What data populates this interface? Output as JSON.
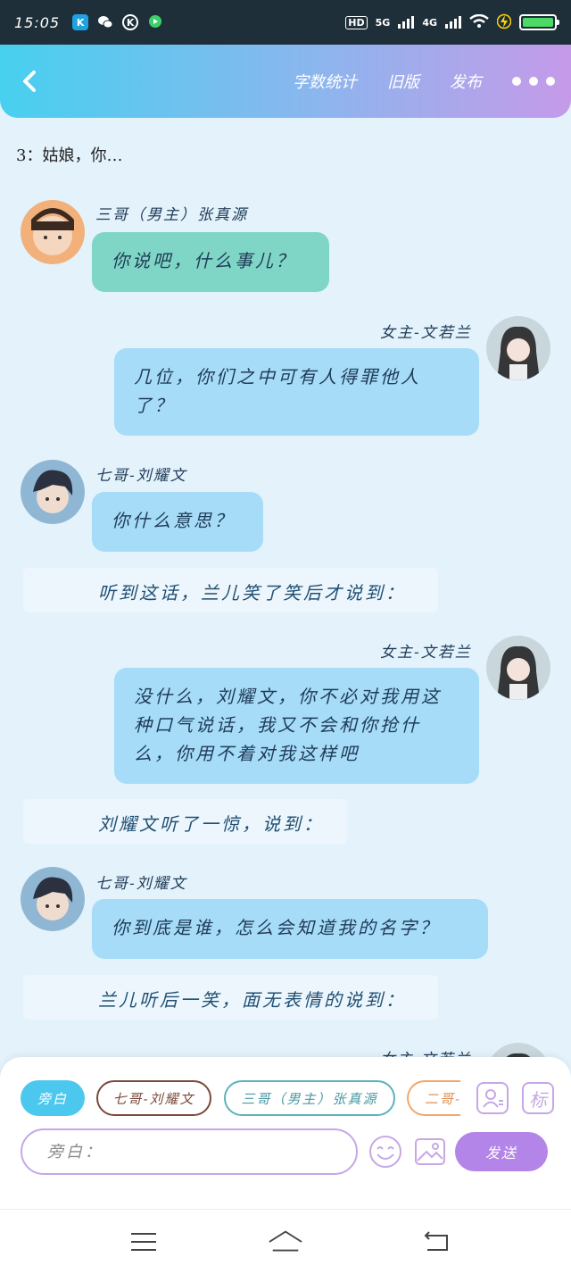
{
  "status_bar": {
    "time": "15:05",
    "app_icons": [
      "k-app-icon",
      "wechat-icon",
      "k-circle-icon",
      "video-app-icon"
    ],
    "signal_labels": [
      "HD",
      "5G",
      "4G"
    ],
    "battery_level": "Charging"
  },
  "header": {
    "actions": [
      "字数统计",
      "旧版",
      "发布"
    ]
  },
  "chapter_title": "3：姑娘，你…",
  "messages": [
    {
      "type": "left",
      "name": "三哥（男主）张真源",
      "text": "你说吧，什么事儿？",
      "color": "green"
    },
    {
      "type": "right",
      "name": "女主-文若兰",
      "text": "几位，你们之中可有人得罪他人了？",
      "color": "blue"
    },
    {
      "type": "left",
      "name": "七哥-刘耀文",
      "text": "你什么意思？",
      "color": "blue"
    },
    {
      "type": "narration",
      "text": "听到这话，兰儿笑了笑后才说到："
    },
    {
      "type": "right",
      "name": "女主-文若兰",
      "text": "没什么，刘耀文，你不必对我用这种口气说话，我又不会和你抢什么，你用不着对我这样吧",
      "color": "blue"
    },
    {
      "type": "narration",
      "text": "刘耀文听了一惊，说到："
    },
    {
      "type": "left",
      "name": "七哥-刘耀文",
      "text": "你到底是谁，怎么会知道我的名字？",
      "color": "blue"
    },
    {
      "type": "narration",
      "text": "兰儿听后一笑，面无表情的说到："
    },
    {
      "type": "right",
      "name": "女主-文若兰",
      "text": "",
      "color": "blue"
    }
  ],
  "composer": {
    "chips": [
      "旁白",
      "七哥-刘耀文",
      "三哥（男主）张真源",
      "二哥-"
    ],
    "input_placeholder": "旁白：",
    "send_label": "发送",
    "tag_label": "标"
  },
  "colors": {
    "header_gradient": [
      "#47d0ef",
      "#c59ae9"
    ],
    "green_bubble": "#7fd6c6",
    "blue_bubble": "#a6dcf8",
    "send_button": "#b485e8",
    "active_chip": "#4cc8ef"
  }
}
